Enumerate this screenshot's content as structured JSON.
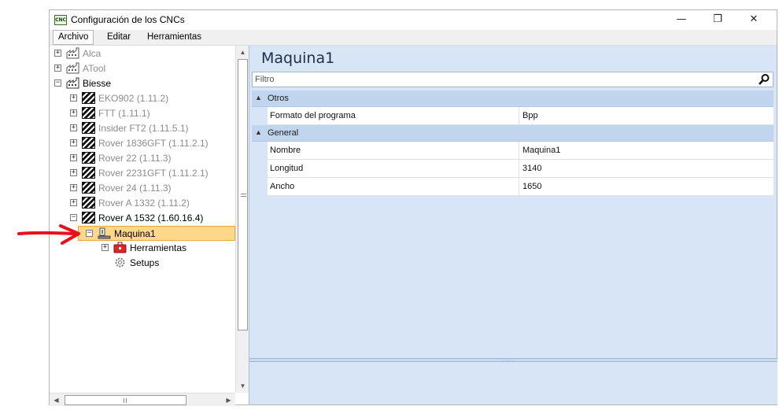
{
  "window": {
    "title": "Configuración de los CNCs",
    "app_icon_text": "CNC",
    "min_glyph": "—",
    "max_glyph": "❐",
    "close_glyph": "✕"
  },
  "menu": [
    "Archivo",
    "Editar",
    "Herramientas"
  ],
  "tree": {
    "items": [
      {
        "label": "Alca",
        "expander": "+",
        "icon": "factory-icon"
      },
      {
        "label": "ATool",
        "expander": "+",
        "icon": "factory-icon"
      },
      {
        "label": "Biesse",
        "expander": "−",
        "icon": "factory-icon"
      },
      {
        "label": "EKO902 (1.11.2)",
        "expander": "+",
        "icon": "cnc-machine-icon"
      },
      {
        "label": "FTT (1.11.1)",
        "expander": "+",
        "icon": "cnc-machine-icon"
      },
      {
        "label": "Insider FT2 (1.11.5.1)",
        "expander": "+",
        "icon": "cnc-machine-icon"
      },
      {
        "label": "Rover 1836GFT (1.11.2.1)",
        "expander": "+",
        "icon": "cnc-machine-icon"
      },
      {
        "label": "Rover 22 (1.11.3)",
        "expander": "+",
        "icon": "cnc-machine-icon"
      },
      {
        "label": "Rover 2231GFT (1.11.2.1)",
        "expander": "+",
        "icon": "cnc-machine-icon"
      },
      {
        "label": "Rover 24 (1.11.3)",
        "expander": "+",
        "icon": "cnc-machine-icon"
      },
      {
        "label": "Rover A 1332 (1.11.2)",
        "expander": "+",
        "icon": "cnc-machine-icon"
      },
      {
        "label": "Rover A 1532 (1.60.16.4)",
        "expander": "−",
        "icon": "cnc-machine-icon"
      },
      {
        "label": "Maquina1",
        "expander": "−",
        "icon": "machine-icon",
        "selected": true
      },
      {
        "label": "Herramientas",
        "expander": "+",
        "icon": "toolbox-icon"
      },
      {
        "label": "Setups",
        "icon": "gear-icon"
      }
    ]
  },
  "panel": {
    "title": "Maquina1",
    "filter_placeholder": "Filtro",
    "categories": [
      {
        "name": "Otros",
        "rows": [
          {
            "key": "Formato del programa",
            "value": "Bpp"
          }
        ]
      },
      {
        "name": "General",
        "rows": [
          {
            "key": "Nombre",
            "value": "Maquina1"
          },
          {
            "key": "Longitud",
            "value": "3140"
          },
          {
            "key": "Ancho",
            "value": "1650"
          }
        ]
      }
    ],
    "splitter_dots": "·····"
  },
  "colors": {
    "selection": "#fdd78a",
    "panel_bg": "#d7e5f6",
    "category_bg": "#c1d5ee",
    "annotation_arrow": "#e8101b"
  }
}
